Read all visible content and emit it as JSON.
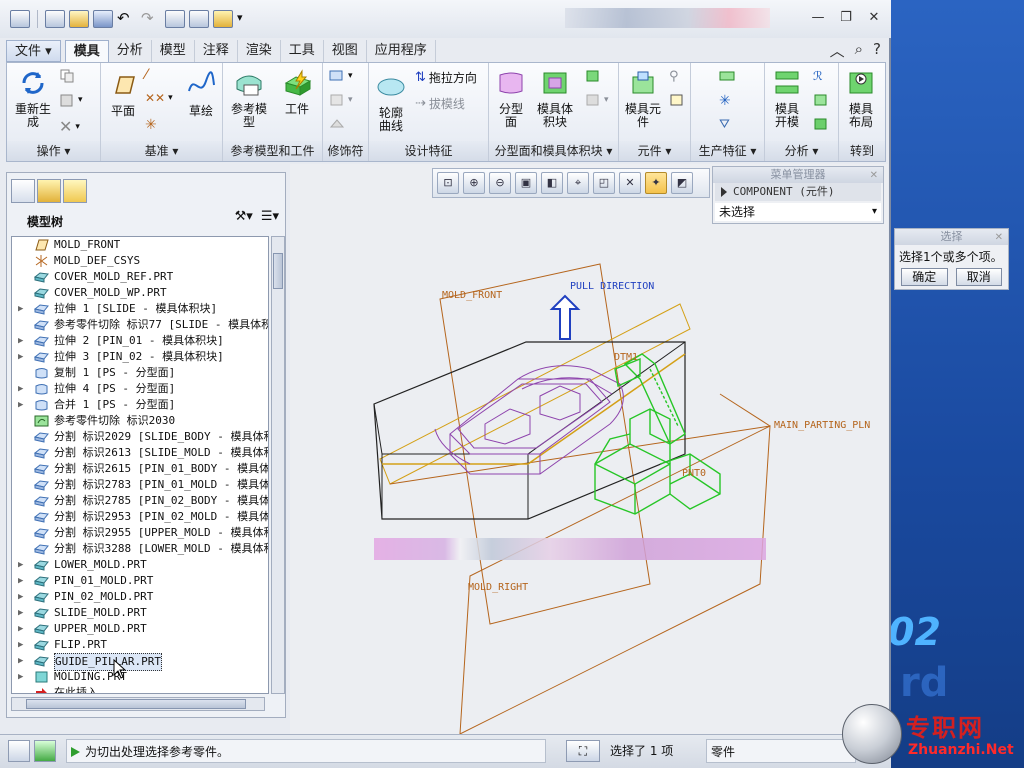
{
  "desktop": {
    "brand_number": "02",
    "brand_letters": "rd"
  },
  "quick_access": {
    "icons": [
      "app-icon",
      "new-icon",
      "open-icon",
      "save-icon",
      "undo-icon",
      "redo-icon",
      "regenerate-icon",
      "windows-icon",
      "folder-icon",
      "customize-icon"
    ]
  },
  "window": {
    "minimize": "—",
    "restore": "❐",
    "close": "✕"
  },
  "tabs": [
    "文件",
    "模具",
    "分析",
    "模型",
    "注释",
    "渲染",
    "工具",
    "视图",
    "应用程序"
  ],
  "active_tab": "模具",
  "ribbon": {
    "groups": [
      {
        "label": "操作",
        "dropdown": true
      },
      {
        "label": "基准",
        "dropdown": true
      },
      {
        "label": "参考模型和工件",
        "dropdown": false
      },
      {
        "label": "修饰符",
        "dropdown": false
      },
      {
        "label": "设计特征",
        "dropdown": false
      },
      {
        "label": "分型面和模具体积块",
        "dropdown": true
      },
      {
        "label": "元件",
        "dropdown": true
      },
      {
        "label": "生产特征",
        "dropdown": true
      },
      {
        "label": "分析",
        "dropdown": true
      },
      {
        "label": "转到",
        "dropdown": false
      }
    ],
    "buttons": {
      "regenerate": "重新生\n成",
      "plane": "平面",
      "sketch": "草绘",
      "ref_model": "参考模\n型",
      "workpiece": "工件",
      "contour_curve": "轮廓\n曲线",
      "drag_direction": "拖拉方向",
      "draft_line": "拔模线",
      "parting_surface": "分型\n面",
      "mold_volume": "模具体\n积块",
      "mold_component": "模具元\n件",
      "mold_open": "模具\n开模",
      "mold_layout": "模具\n布局"
    }
  },
  "model_tree": {
    "title": "模型树",
    "items": [
      {
        "label": "MOLD_FRONT",
        "icon": "datum-plane-icon",
        "expandable": false
      },
      {
        "label": "MOLD_DEF_CSYS",
        "icon": "csys-icon",
        "expandable": false
      },
      {
        "label": "COVER_MOLD_REF.PRT",
        "icon": "part-icon",
        "expandable": false
      },
      {
        "label": "COVER_MOLD_WP.PRT",
        "icon": "part-icon",
        "expandable": false
      },
      {
        "label": "拉伸 1 [SLIDE - 模具体积块]",
        "icon": "extrude-icon",
        "expandable": true
      },
      {
        "label": "参考零件切除 标识77 [SLIDE - 模具体积",
        "icon": "extrude-icon",
        "expandable": false
      },
      {
        "label": "拉伸 2 [PIN_01 - 模具体积块]",
        "icon": "extrude-icon",
        "expandable": true
      },
      {
        "label": "拉伸 3 [PIN_02 - 模具体积块]",
        "icon": "extrude-icon",
        "expandable": true
      },
      {
        "label": "复制 1 [PS - 分型面]",
        "icon": "surface-icon",
        "expandable": false
      },
      {
        "label": "拉伸 4 [PS - 分型面]",
        "icon": "surface-icon",
        "expandable": true
      },
      {
        "label": "合并 1 [PS - 分型面]",
        "icon": "surface-icon",
        "expandable": true
      },
      {
        "label": "参考零件切除 标识2030",
        "icon": "cut-icon",
        "expandable": false
      },
      {
        "label": "分割 标识2029 [SLIDE_BODY - 模具体积",
        "icon": "split-icon",
        "expandable": false
      },
      {
        "label": "分割 标识2613 [SLIDE_MOLD - 模具体积",
        "icon": "split-icon",
        "expandable": false
      },
      {
        "label": "分割 标识2615 [PIN_01_BODY - 模具体积",
        "icon": "split-icon",
        "expandable": false
      },
      {
        "label": "分割 标识2783 [PIN_01_MOLD - 模具体积",
        "icon": "split-icon",
        "expandable": false
      },
      {
        "label": "分割 标识2785 [PIN_02_BODY - 模具体积",
        "icon": "split-icon",
        "expandable": false
      },
      {
        "label": "分割 标识2953 [PIN_02_MOLD - 模具体积",
        "icon": "split-icon",
        "expandable": false
      },
      {
        "label": "分割 标识2955 [UPPER_MOLD - 模具体积",
        "icon": "split-icon",
        "expandable": false
      },
      {
        "label": "分割 标识3288 [LOWER_MOLD - 模具体积",
        "icon": "split-icon",
        "expandable": false
      },
      {
        "label": "LOWER_MOLD.PRT",
        "icon": "part-icon",
        "expandable": true
      },
      {
        "label": "PIN_01_MOLD.PRT",
        "icon": "part-icon",
        "expandable": true
      },
      {
        "label": "PIN_02_MOLD.PRT",
        "icon": "part-icon",
        "expandable": true
      },
      {
        "label": "SLIDE_MOLD.PRT",
        "icon": "part-icon",
        "expandable": true
      },
      {
        "label": "UPPER_MOLD.PRT",
        "icon": "part-icon",
        "expandable": true
      },
      {
        "label": "FLIP.PRT",
        "icon": "part-icon",
        "expandable": true
      },
      {
        "label": "GUIDE_PILLAR.PRT",
        "icon": "part-icon",
        "expandable": true,
        "selected": true
      },
      {
        "label": "MOLDING.PRT",
        "icon": "molding-icon",
        "expandable": true
      },
      {
        "label": "在此插入",
        "icon": "insert-arrow-icon",
        "expandable": false
      }
    ]
  },
  "graphics": {
    "labels": {
      "mold_front": "MOLD_FRONT",
      "pull_direction": "PULL DIRECTION",
      "dtm1": "DTM1",
      "main_parting": "MAIN_PARTING_PLN",
      "pnt0": "PNT0",
      "mold_right": "MOLD_RIGHT"
    },
    "colors": {
      "datum": "#b5651d",
      "ref_model": "#8e44ad",
      "component": "#27c627",
      "pull_arrow": "#2040c0",
      "box": "#222222"
    }
  },
  "menu_manager": {
    "title": "菜单管理器",
    "item": "COMPONENT (元件)",
    "selection": "未选择"
  },
  "select_dialog": {
    "title": "选择",
    "message": "选择1个或多个项。",
    "ok": "确定",
    "cancel": "取消"
  },
  "status": {
    "message": "为切出处理选择参考零件。",
    "selected": "选择了 1 项",
    "filter": "零件"
  },
  "watermark": {
    "cn": "专职网",
    "en": "Zhuanzhi.Net"
  }
}
